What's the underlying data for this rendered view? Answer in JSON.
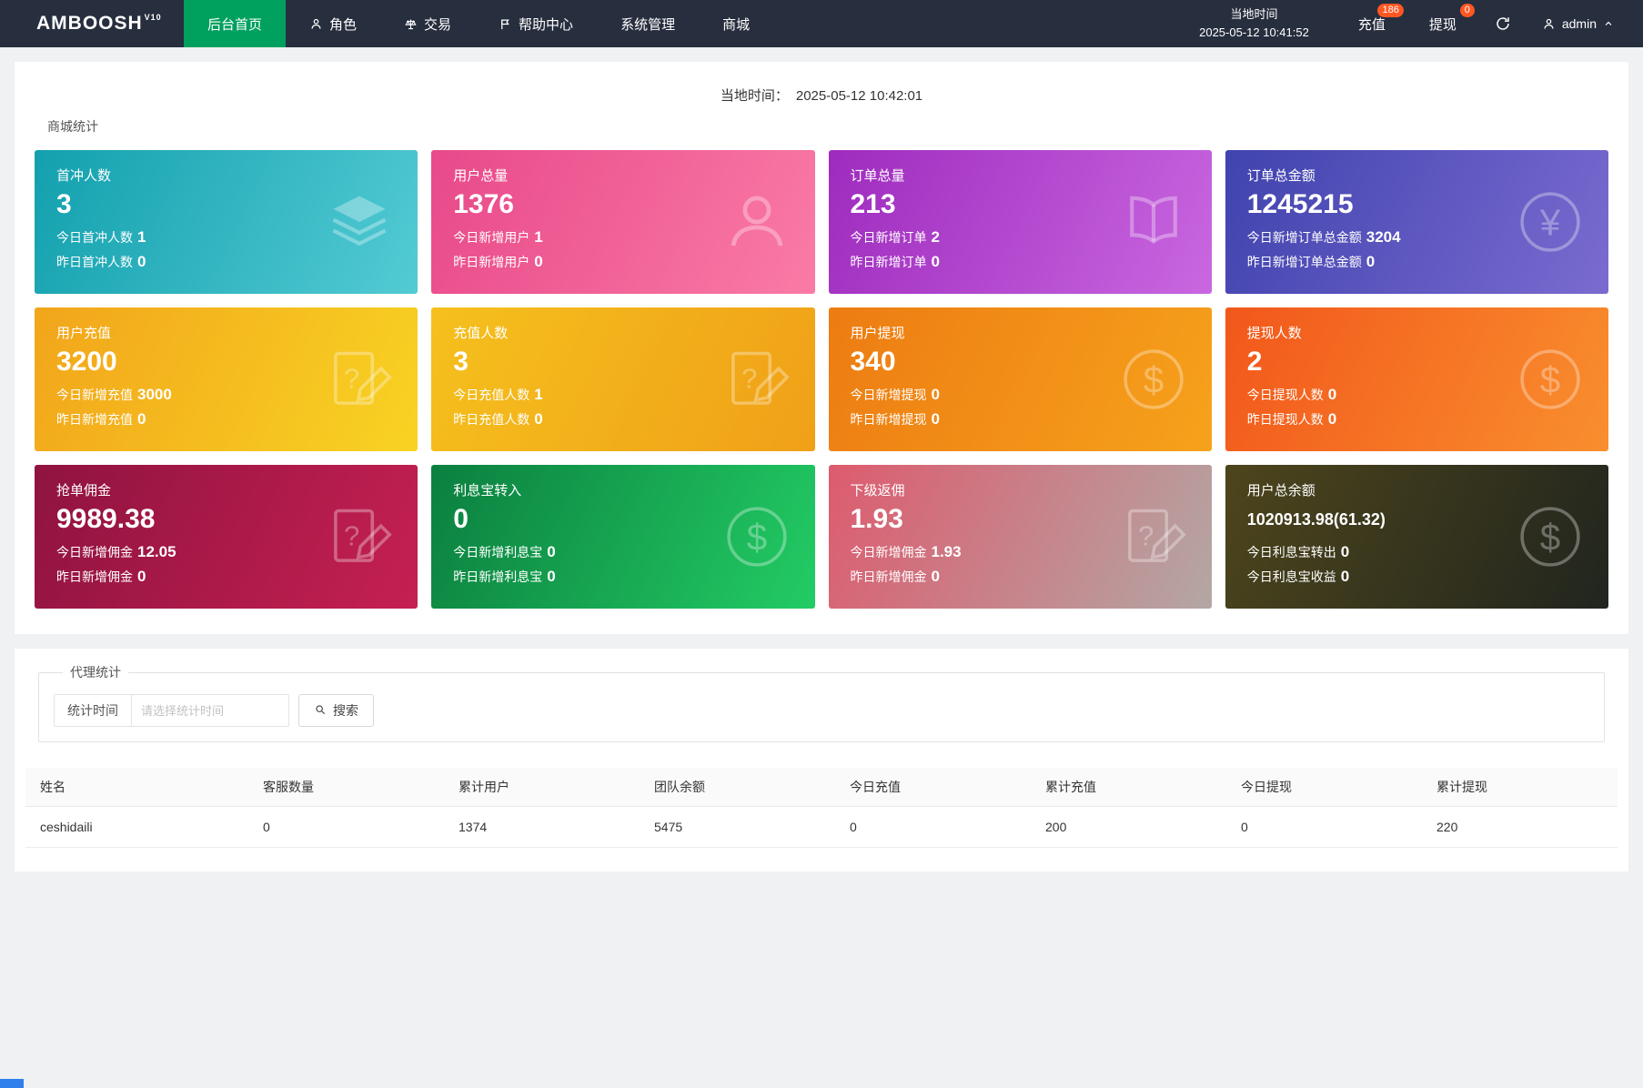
{
  "colors": {
    "navbar_bg": "#272e3e",
    "active_menu_bg": "#00a05e",
    "badge_bg": "#ff5722",
    "page_bg": "#f0f1f2"
  },
  "navbar": {
    "logo": "AMBOOSH",
    "logo_version": "V10",
    "menu": [
      {
        "label": "后台首页",
        "icon": null,
        "active": true
      },
      {
        "label": "角色",
        "icon": "person-icon",
        "active": false
      },
      {
        "label": "交易",
        "icon": "scale-icon",
        "active": false
      },
      {
        "label": "帮助中心",
        "icon": "flag-icon",
        "active": false
      },
      {
        "label": "系统管理",
        "icon": null,
        "active": false
      },
      {
        "label": "商城",
        "icon": null,
        "active": false
      }
    ],
    "local_time": {
      "label": "当地时间",
      "value": "2025-05-12 10:41:52"
    },
    "recharge": {
      "label": "充值",
      "badge": "186"
    },
    "withdraw": {
      "label": "提现",
      "badge": "0"
    },
    "username": "admin"
  },
  "overview": {
    "time_label": "当地时间：",
    "time_value": "2025-05-12 10:42:01",
    "section_title": "商城统计",
    "cards": [
      {
        "title": "首冲人数",
        "value": "3",
        "small_value": false,
        "line1_label": "今日首冲人数",
        "line1_value": "1",
        "line2_label": "昨日首冲人数",
        "line2_value": "0",
        "icon": "layers-icon",
        "gradient": [
          "#13a0ae",
          "#53cbd4"
        ]
      },
      {
        "title": "用户总量",
        "value": "1376",
        "small_value": false,
        "line1_label": "今日新增用户",
        "line1_value": "1",
        "line2_label": "昨日新增用户",
        "line2_value": "0",
        "icon": "user-icon",
        "gradient": [
          "#e8498a",
          "#fa7ba6"
        ]
      },
      {
        "title": "订单总量",
        "value": "213",
        "small_value": false,
        "line1_label": "今日新增订单",
        "line1_value": "2",
        "line2_label": "昨日新增订单",
        "line2_value": "0",
        "icon": "book-icon",
        "gradient": [
          "#9e2bbe",
          "#c967e0"
        ]
      },
      {
        "title": "订单总金额",
        "value": "1245215",
        "small_value": false,
        "line1_label": "今日新增订单总金额",
        "line1_value": "3204",
        "line2_label": "昨日新增订单总金额",
        "line2_value": "0",
        "icon": "yen-icon",
        "gradient": [
          "#4043ae",
          "#7a6bd0"
        ]
      },
      {
        "title": "用户充值",
        "value": "3200",
        "small_value": false,
        "line1_label": "今日新增充值",
        "line1_value": "3000",
        "line2_label": "昨日新增充值",
        "line2_value": "0",
        "icon": "doc-edit-icon",
        "gradient": [
          "#f2a51b",
          "#f8d323"
        ]
      },
      {
        "title": "充值人数",
        "value": "3",
        "small_value": false,
        "line1_label": "今日充值人数",
        "line1_value": "1",
        "line2_label": "昨日充值人数",
        "line2_value": "0",
        "icon": "doc-edit-icon",
        "gradient": [
          "#f5c01d",
          "#f0a018"
        ]
      },
      {
        "title": "用户提现",
        "value": "340",
        "small_value": false,
        "line1_label": "今日新增提现",
        "line1_value": "0",
        "line2_label": "昨日新增提现",
        "line2_value": "0",
        "icon": "dollar-icon",
        "gradient": [
          "#ed7c12",
          "#f6a21c"
        ]
      },
      {
        "title": "提现人数",
        "value": "2",
        "small_value": false,
        "line1_label": "今日提现人数",
        "line1_value": "0",
        "line2_label": "昨日提现人数",
        "line2_value": "0",
        "icon": "dollar-icon",
        "gradient": [
          "#f2571b",
          "#f98f2e"
        ]
      },
      {
        "title": "抢单佣金",
        "value": "9989.38",
        "small_value": false,
        "line1_label": "今日新增佣金",
        "line1_value": "12.05",
        "line2_label": "昨日新增佣金",
        "line2_value": "0",
        "icon": "doc-edit-icon",
        "gradient": [
          "#8f1340",
          "#c52052"
        ]
      },
      {
        "title": "利息宝转入",
        "value": "0",
        "small_value": false,
        "line1_label": "今日新增利息宝",
        "line1_value": "0",
        "line2_label": "昨日新增利息宝",
        "line2_value": "0",
        "icon": "dollar-icon",
        "gradient": [
          "#0b7f3f",
          "#23cc64"
        ]
      },
      {
        "title": "下级返佣",
        "value": "1.93",
        "small_value": false,
        "line1_label": "今日新增佣金",
        "line1_value": "1.93",
        "line2_label": "昨日新增佣金",
        "line2_value": "0",
        "icon": "doc-edit-icon",
        "gradient": [
          "#dd5b6e",
          "#b3a7a4"
        ]
      },
      {
        "title": "用户总余额",
        "value": "1020913.98(61.32)",
        "small_value": true,
        "line1_label": "今日利息宝转出",
        "line1_value": "0",
        "line2_label": "今日利息宝收益",
        "line2_value": "0",
        "icon": "dollar-icon",
        "gradient": [
          "#4d451c",
          "#21251e"
        ]
      }
    ]
  },
  "agent_stats": {
    "legend": "代理统计",
    "filter_label": "统计时间",
    "filter_placeholder": "请选择统计时间",
    "search_label": "搜索",
    "table": {
      "headers": [
        "姓名",
        "客服数量",
        "累计用户",
        "团队余额",
        "今日充值",
        "累计充值",
        "今日提现",
        "累计提现"
      ],
      "rows": [
        [
          "ceshidaili",
          "0",
          "1374",
          "5475",
          "0",
          "200",
          "0",
          "220"
        ]
      ]
    }
  }
}
